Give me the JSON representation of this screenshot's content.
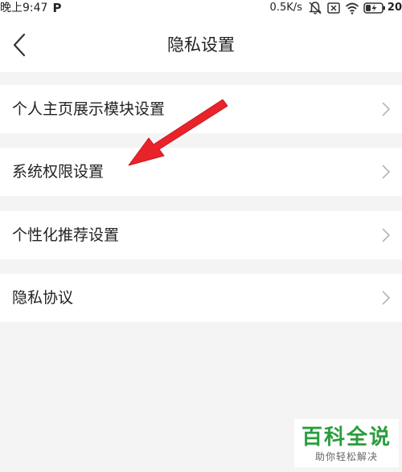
{
  "status_bar": {
    "time": "晚上9:47",
    "app_indicator": "P",
    "network_speed": "0.5K/s",
    "battery_percent": "20",
    "icons": [
      "bell-muted-icon",
      "sim-none-icon",
      "wifi-icon",
      "battery-charging-icon"
    ]
  },
  "header": {
    "title": "隐私设置",
    "back_icon": "chevron-left-icon"
  },
  "menu": {
    "items": [
      {
        "label": "个人主页展示模块设置"
      },
      {
        "label": "系统权限设置"
      },
      {
        "label": "个性化推荐设置"
      },
      {
        "label": "隐私协议"
      }
    ],
    "chevron_icon": "chevron-right-icon"
  },
  "annotation": {
    "arrow_color": "#e8232a",
    "icon": "red-arrow-icon"
  },
  "watermark": {
    "title": "百科全说",
    "subtitle": "助你轻松解决",
    "color": "#2a9d3d"
  }
}
